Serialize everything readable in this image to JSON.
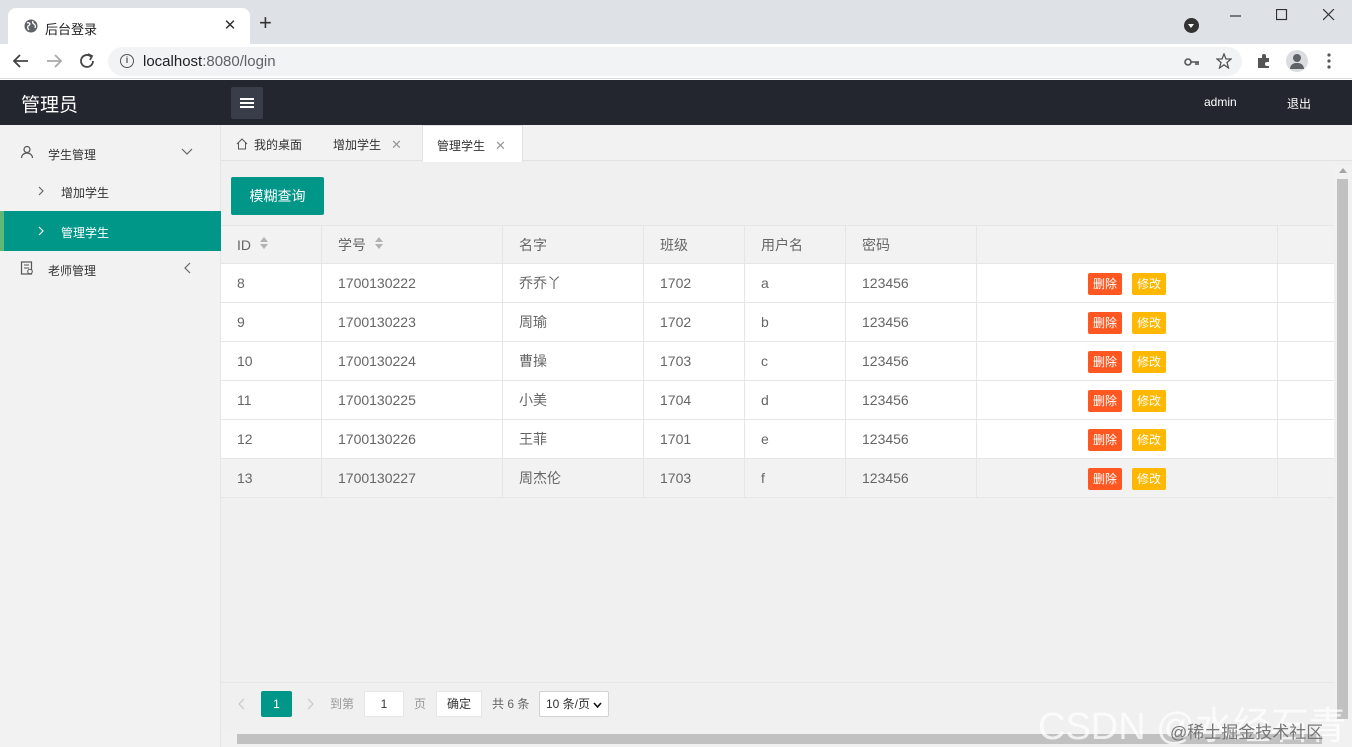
{
  "browser": {
    "tab_title": "后台登录",
    "tab_close": "✕",
    "new_tab": "+",
    "url_host": "localhost",
    "url_rest": ":8080/login"
  },
  "header": {
    "logo": "管理员",
    "user": "admin",
    "logout": "退出"
  },
  "sidebar": {
    "items": [
      {
        "label": "学生管理"
      },
      {
        "label": "增加学生"
      },
      {
        "label": "管理学生"
      },
      {
        "label": "老师管理"
      }
    ]
  },
  "tabs": [
    {
      "label": "我的桌面"
    },
    {
      "label": "增加学生"
    },
    {
      "label": "管理学生"
    }
  ],
  "search_button": "模糊查询",
  "table": {
    "columns": [
      "ID",
      "学号",
      "名字",
      "班级",
      "用户名",
      "密码"
    ],
    "rows": [
      {
        "id": "8",
        "no": "1700130222",
        "name": "乔乔丫",
        "class": "1702",
        "user": "a",
        "pwd": "123456"
      },
      {
        "id": "9",
        "no": "1700130223",
        "name": "周瑜",
        "class": "1702",
        "user": "b",
        "pwd": "123456"
      },
      {
        "id": "10",
        "no": "1700130224",
        "name": "曹操",
        "class": "1703",
        "user": "c",
        "pwd": "123456"
      },
      {
        "id": "11",
        "no": "1700130225",
        "name": "小美",
        "class": "1704",
        "user": "d",
        "pwd": "123456"
      },
      {
        "id": "12",
        "no": "1700130226",
        "name": "王菲",
        "class": "1701",
        "user": "e",
        "pwd": "123456"
      },
      {
        "id": "13",
        "no": "1700130227",
        "name": "周杰伦",
        "class": "1703",
        "user": "f",
        "pwd": "123456"
      }
    ],
    "delete_label": "删除",
    "edit_label": "修改"
  },
  "pager": {
    "current": "1",
    "goto_prefix": "到第",
    "goto_value": "1",
    "goto_suffix": "页",
    "confirm": "确定",
    "total": "共 6 条",
    "page_size": "10 条/页"
  },
  "watermark": "CSDN @水经石青",
  "watermark2": "@稀土掘金技术社区",
  "colors": {
    "header_bg": "#23262e",
    "accent": "#009688",
    "delete": "#ff5722",
    "edit": "#ffb800"
  }
}
